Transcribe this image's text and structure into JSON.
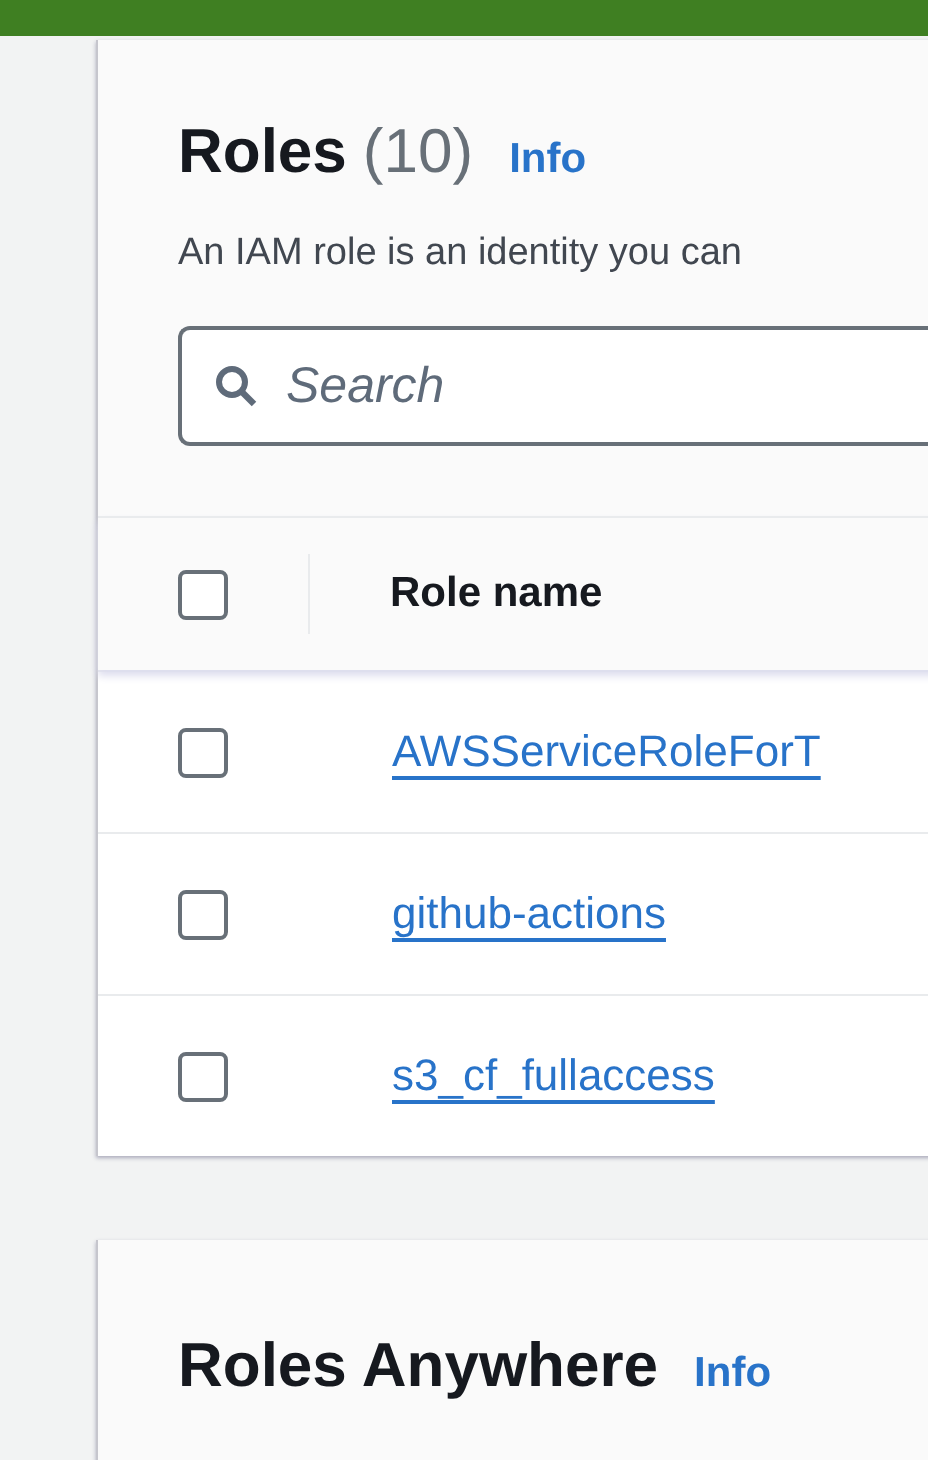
{
  "roles": {
    "title": "Roles",
    "count": "(10)",
    "info": "Info",
    "description": "An IAM role is an identity you can",
    "search": {
      "placeholder": "Search"
    },
    "table": {
      "header_checked": false,
      "columns": [
        "Role name"
      ],
      "rows": [
        {
          "name": "AWSServiceRoleForT",
          "checked": false
        },
        {
          "name": "github-actions",
          "checked": false
        },
        {
          "name": "s3_cf_fullaccess",
          "checked": false
        }
      ]
    }
  },
  "roles_anywhere": {
    "title": "Roles Anywhere",
    "info": "Info"
  }
}
